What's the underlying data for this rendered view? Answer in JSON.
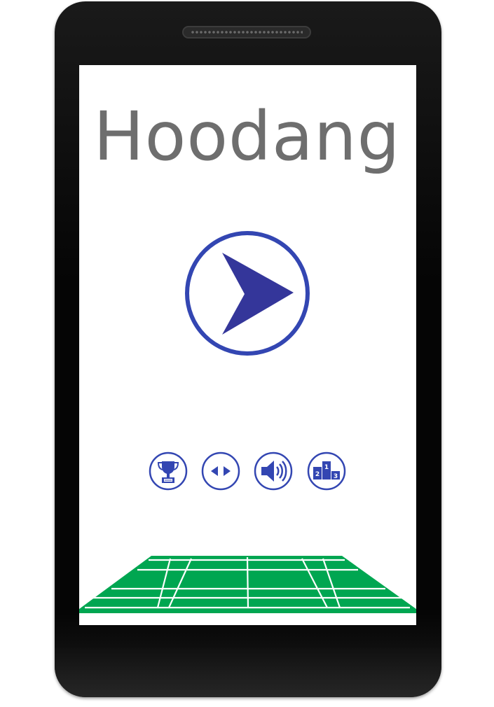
{
  "app": {
    "title": "Hoodang"
  },
  "colors": {
    "accent": "#3346B2",
    "play_arrow": "#34369A",
    "title_text": "#6E6E6E",
    "court_green": "#00A651",
    "court_lines": "#FFFFFF",
    "phone_body": "#0A0A0A"
  },
  "icons": {
    "play": "play-icon",
    "trophy": "trophy-icon",
    "arrows": "left-right-arrows-icon",
    "sound": "speaker-volume-icon",
    "leaderboard": "podium-icon"
  },
  "podium_labels": [
    "2",
    "1",
    "3"
  ]
}
